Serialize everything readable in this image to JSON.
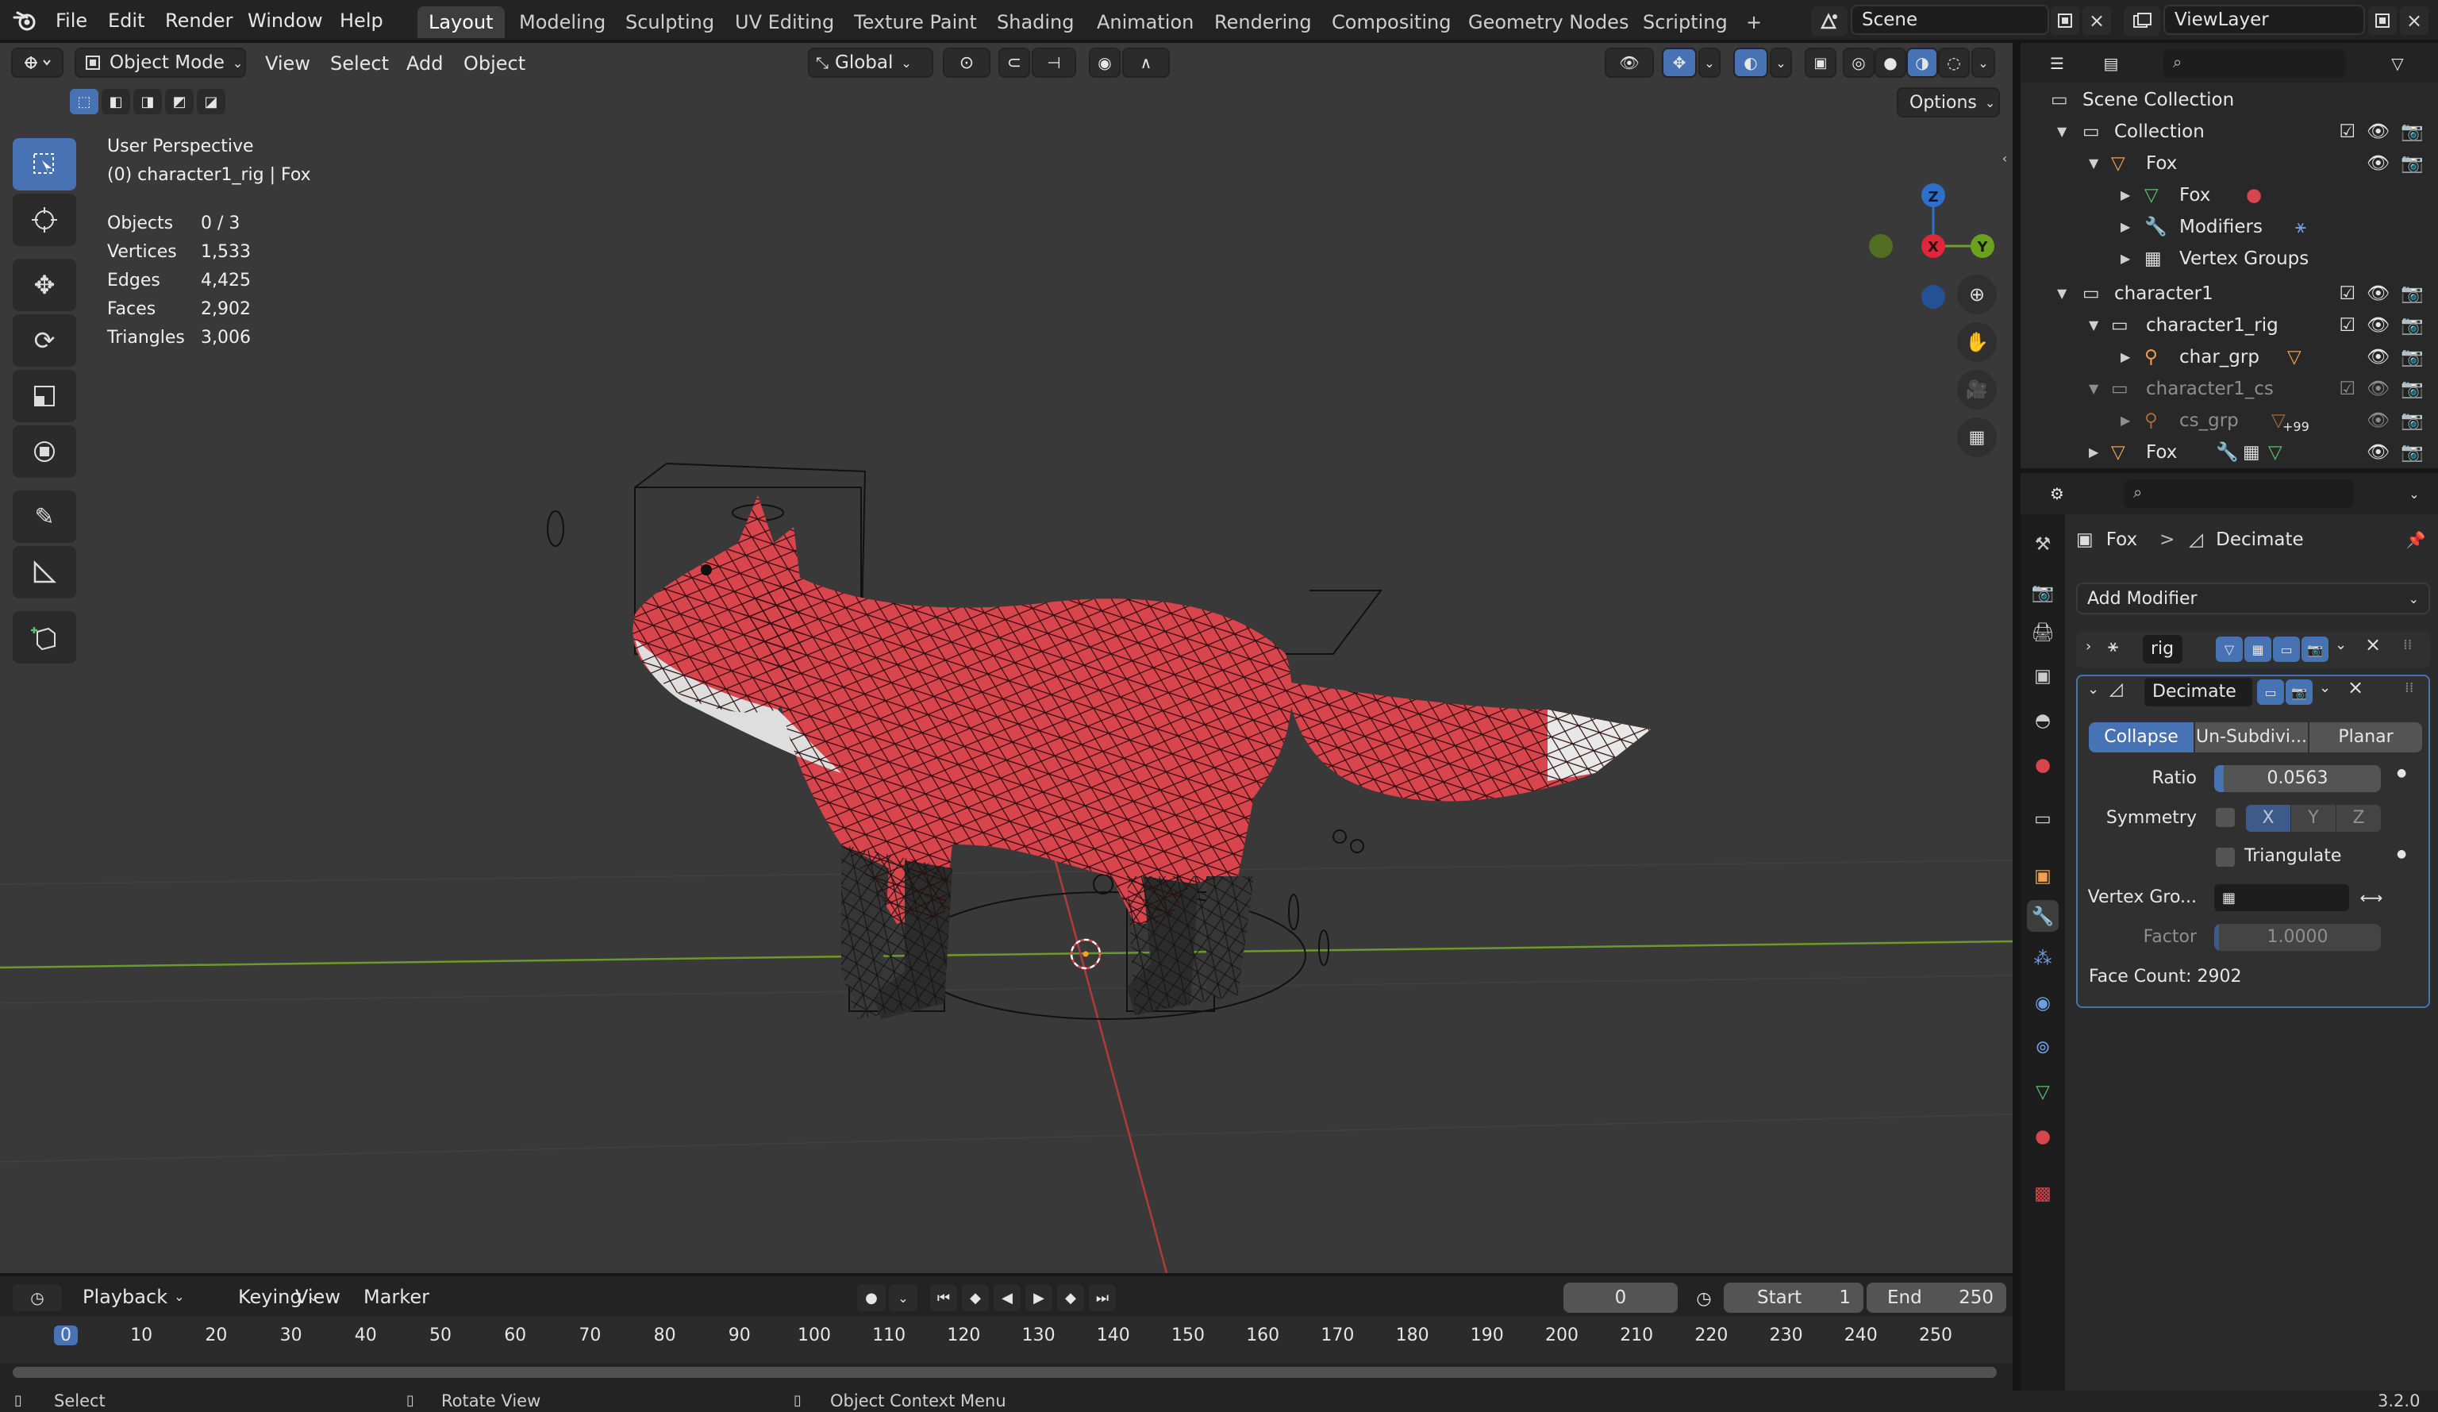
{
  "topbar": {
    "menus": [
      "File",
      "Edit",
      "Render",
      "Window",
      "Help"
    ],
    "workspaces": [
      "Layout",
      "Modeling",
      "Sculpting",
      "UV Editing",
      "Texture Paint",
      "Shading",
      "Animation",
      "Rendering",
      "Compositing",
      "Geometry Nodes",
      "Scripting"
    ],
    "active_workspace": "Layout",
    "add_workspace": "+",
    "scene": "Scene",
    "view_layer": "ViewLayer"
  },
  "viewport": {
    "mode": "Object Mode",
    "menus": [
      "View",
      "Select",
      "Add",
      "Object"
    ],
    "transform_orientation": "Global",
    "options_label": "Options",
    "overlay_title": "User Perspective",
    "overlay_subtitle": "(0) character1_rig | Fox",
    "gizmo": {
      "z": "Z",
      "x": "X",
      "y": "Y"
    },
    "stats": [
      {
        "label": "Objects",
        "value": "0 / 3"
      },
      {
        "label": "Vertices",
        "value": "1,533"
      },
      {
        "label": "Edges",
        "value": "4,425"
      },
      {
        "label": "Faces",
        "value": "2,902"
      },
      {
        "label": "Triangles",
        "value": "3,006"
      }
    ],
    "colors": {
      "background": "#393939",
      "fox_body": "#d9454d",
      "accent": "#4772b3"
    }
  },
  "timeline": {
    "menus": [
      "Playback",
      "Keying",
      "View",
      "Marker"
    ],
    "current_frame": "0",
    "start_label": "Start",
    "start_value": "1",
    "end_label": "End",
    "end_value": "250",
    "ruler": [
      "0",
      "10",
      "20",
      "30",
      "40",
      "50",
      "60",
      "70",
      "80",
      "90",
      "100",
      "110",
      "120",
      "130",
      "140",
      "150",
      "160",
      "170",
      "180",
      "190",
      "200",
      "210",
      "220",
      "230",
      "240",
      "250"
    ]
  },
  "status": {
    "select": "Select",
    "rotate": "Rotate View",
    "context": "Object Context Menu",
    "version": "3.2.0"
  },
  "outliner": {
    "scene_collection": "Scene Collection",
    "rows": [
      {
        "label": "Collection"
      },
      {
        "label": "Fox"
      },
      {
        "label": "Fox"
      },
      {
        "label": "Modifiers"
      },
      {
        "label": "Vertex Groups"
      },
      {
        "label": "character1"
      },
      {
        "label": "character1_rig"
      },
      {
        "label": "char_grp"
      },
      {
        "label": "character1_cs"
      },
      {
        "label": "cs_grp"
      },
      {
        "label": "Fox"
      }
    ],
    "badge": "+99"
  },
  "properties": {
    "breadcrumb_object": "Fox",
    "breadcrumb_sep": ">",
    "breadcrumb_modifier": "Decimate",
    "add_modifier": "Add Modifier",
    "rig_modifier": "rig",
    "decimate": {
      "name": "Decimate",
      "modes": [
        "Collapse",
        "Un-Subdivi...",
        "Planar"
      ],
      "active_mode": "Collapse",
      "ratio_label": "Ratio",
      "ratio_value": "0.0563",
      "ratio_fraction": 0.0563,
      "symmetry_label": "Symmetry",
      "axes": [
        "X",
        "Y",
        "Z"
      ],
      "triangulate_label": "Triangulate",
      "vertex_group_label": "Vertex Gro...",
      "factor_label": "Factor",
      "factor_value": "1.0000",
      "face_count": "Face Count: 2902"
    }
  }
}
